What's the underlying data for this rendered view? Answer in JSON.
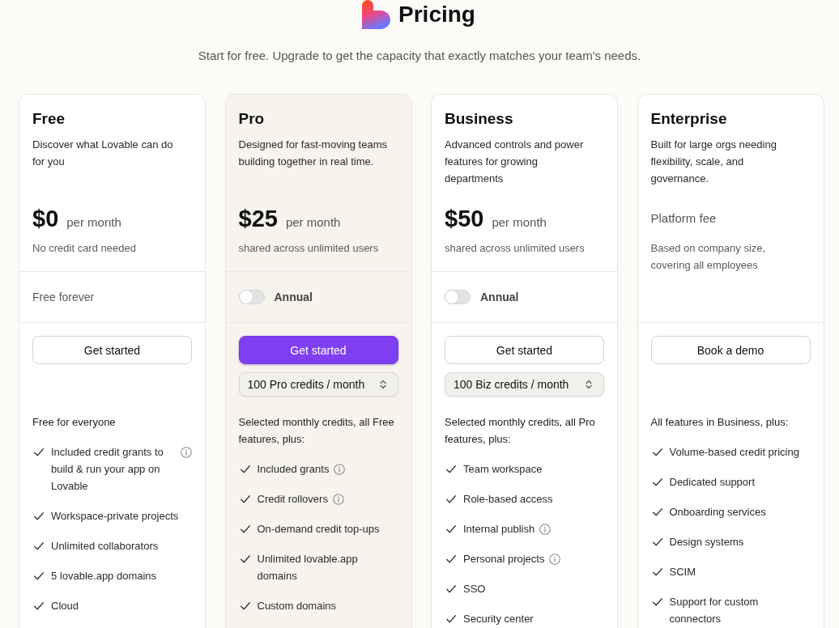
{
  "header": {
    "title": "Pricing",
    "subtitle": "Start for free. Upgrade to get the capacity that exactly matches your team's needs."
  },
  "plans": [
    {
      "name": "Free",
      "highlighted": false,
      "description": "Discover what Lovable can do for you",
      "price": {
        "kind": "amount",
        "amount": "$0",
        "period": "per month"
      },
      "price_note": "No credit card needed",
      "billing": {
        "kind": "note",
        "text": "Free forever"
      },
      "action": {
        "label": "Get started",
        "primary": false
      },
      "features_heading": "Free for everyone",
      "features": [
        {
          "text": "Included credit grants to build & run your app on Lovable",
          "info": true
        },
        {
          "text": "Workspace-private projects",
          "info": false
        },
        {
          "text": "Unlimited collaborators",
          "info": false
        },
        {
          "text": "5 lovable.app domains",
          "info": false
        },
        {
          "text": "Cloud",
          "info": false
        }
      ]
    },
    {
      "name": "Pro",
      "highlighted": true,
      "description": "Designed for fast-moving teams building together in real time.",
      "price": {
        "kind": "amount",
        "amount": "$25",
        "period": "per month"
      },
      "price_note": "shared across unlimited users",
      "billing": {
        "kind": "toggle",
        "label": "Annual",
        "on": false
      },
      "action": {
        "label": "Get started",
        "primary": true
      },
      "credits": "100 Pro credits / month",
      "features_heading": "Selected monthly credits, all Free features, plus:",
      "features": [
        {
          "text": "Included grants",
          "info": true
        },
        {
          "text": "Credit rollovers",
          "info": true
        },
        {
          "text": "On-demand credit top-ups",
          "info": false
        },
        {
          "text": "Unlimited lovable.app domains",
          "info": false
        },
        {
          "text": "Custom domains",
          "info": false
        }
      ]
    },
    {
      "name": "Business",
      "highlighted": false,
      "description": "Advanced controls and power features for growing departments",
      "price": {
        "kind": "amount",
        "amount": "$50",
        "period": "per month"
      },
      "price_note": "shared across unlimited users",
      "billing": {
        "kind": "toggle",
        "label": "Annual",
        "on": false
      },
      "action": {
        "label": "Get started",
        "primary": false
      },
      "credits": "100 Biz credits / month",
      "features_heading": "Selected monthly credits, all Pro features, plus:",
      "features": [
        {
          "text": "Team workspace",
          "info": false
        },
        {
          "text": "Role-based access",
          "info": false
        },
        {
          "text": "Internal publish",
          "info": true
        },
        {
          "text": "Personal projects",
          "info": true
        },
        {
          "text": "SSO",
          "info": false
        },
        {
          "text": "Security center",
          "info": false
        }
      ]
    },
    {
      "name": "Enterprise",
      "highlighted": false,
      "description": "Built for large orgs needing flexibility, scale, and governance.",
      "price": {
        "kind": "label",
        "text": "Platform fee"
      },
      "price_note": "Based on company size, covering all employees",
      "action": {
        "label": "Book a demo",
        "primary": false
      },
      "features_heading": "All features in Business, plus:",
      "features": [
        {
          "text": "Volume-based credit pricing",
          "info": false
        },
        {
          "text": "Dedicated support",
          "info": false
        },
        {
          "text": "Onboarding services",
          "info": false
        },
        {
          "text": "Design systems",
          "info": false
        },
        {
          "text": "SCIM",
          "info": false
        },
        {
          "text": "Support for custom connectors",
          "info": false
        }
      ]
    }
  ]
}
